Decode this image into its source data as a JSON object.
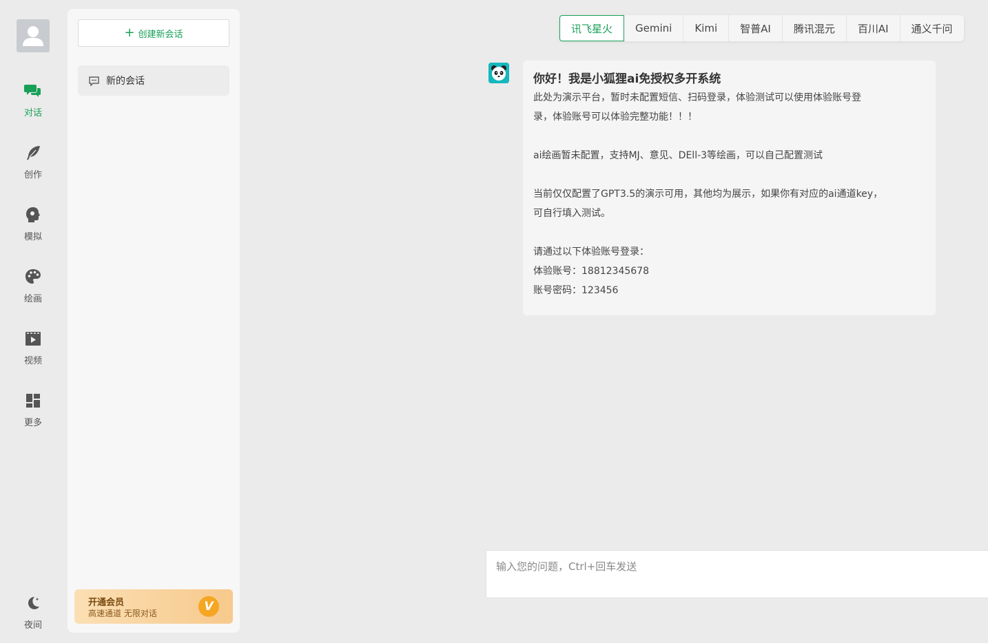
{
  "nav": {
    "items": [
      {
        "label": "对话",
        "icon": "chat-bubbles-icon",
        "active": true
      },
      {
        "label": "创作",
        "icon": "feather-icon"
      },
      {
        "label": "模拟",
        "icon": "head-profile-icon"
      },
      {
        "label": "绘画",
        "icon": "palette-icon"
      },
      {
        "label": "视频",
        "icon": "video-clapper-icon"
      },
      {
        "label": "更多",
        "icon": "dashboard-grid-icon"
      }
    ],
    "night_label": "夜间"
  },
  "sidebar": {
    "new_chat_label": "创建新会话",
    "sessions": [
      {
        "title": "新的会话"
      }
    ],
    "vip": {
      "title": "开通会员",
      "subtitle": "高速通道 无限对话",
      "badge": "V"
    }
  },
  "models": {
    "tabs": [
      "讯飞星火",
      "Gemini",
      "Kimi",
      "智普AI",
      "腾讯混元",
      "百川AI",
      "通义千问"
    ],
    "active": "讯飞星火"
  },
  "message": {
    "title": "你好！我是小狐狸ai免授权多开系统",
    "lines": [
      "此处为演示平台，暂时未配置短信、扫码登录，体验测试可以使用体验账号登",
      "录，体验账号可以体验完整功能！！！",
      "",
      "ai绘画暂未配置，支持MJ、意见、DEll-3等绘画，可以自己配置测试",
      "",
      "当前仅仅配置了GPT3.5的演示可用，其他均为展示，如果你有对应的ai通道key，",
      "可自行填入测试。",
      "",
      "请通过以下体验账号登录：",
      "体验账号：18812345678",
      "账号密码：123456"
    ]
  },
  "input": {
    "placeholder": "输入您的问题，Ctrl+回车发送",
    "value": ""
  },
  "colors": {
    "accent": "#18a058",
    "page_bg": "#ebebeb",
    "vip_start": "#fbdfb4",
    "vip_end": "#f7c98c"
  }
}
